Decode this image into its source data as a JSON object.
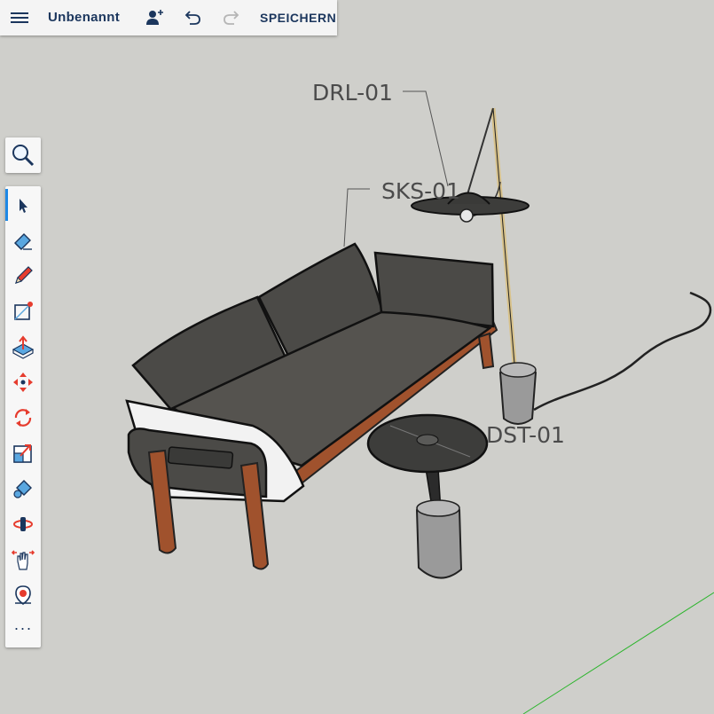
{
  "app": {
    "menu_icon": "hamburger-icon",
    "document_title": "Unbenannt",
    "share_icon": "add-user-icon",
    "undo_icon": "undo-icon",
    "redo_icon": "redo-icon",
    "save_label": "SPEICHERN"
  },
  "toolbar": {
    "search_icon": "search-icon",
    "tools": [
      {
        "name": "select-tool",
        "icon": "cursor-arrow-icon",
        "active": true
      },
      {
        "name": "eraser-tool",
        "icon": "eraser-icon"
      },
      {
        "name": "pencil-tool",
        "icon": "pencil-icon"
      },
      {
        "name": "rectangle-tool",
        "icon": "rectangle-icon"
      },
      {
        "name": "push-pull-tool",
        "icon": "push-pull-icon"
      },
      {
        "name": "move-tool",
        "icon": "move-arrows-icon"
      },
      {
        "name": "rotate-tool",
        "icon": "rotate-icon"
      },
      {
        "name": "scale-tool",
        "icon": "scale-icon"
      },
      {
        "name": "paint-bucket-tool",
        "icon": "paint-bucket-icon"
      },
      {
        "name": "orbit-tool",
        "icon": "orbit-icon"
      },
      {
        "name": "pan-tool",
        "icon": "pan-hand-icon"
      },
      {
        "name": "look-around-tool",
        "icon": "look-around-icon"
      },
      {
        "name": "more-tools",
        "icon": "ellipsis-icon"
      }
    ],
    "more_label": "···"
  },
  "scene": {
    "labels": {
      "floor_lamp": "DRL-01",
      "sofa": "SKS-01",
      "side_table": "DST-01"
    },
    "colors": {
      "background": "#cfcfcb",
      "sofa_fabric": "#4b4a47",
      "wood": "#a0522d",
      "axis_green": "#2db52d",
      "metal": "#9a9a9a"
    }
  }
}
